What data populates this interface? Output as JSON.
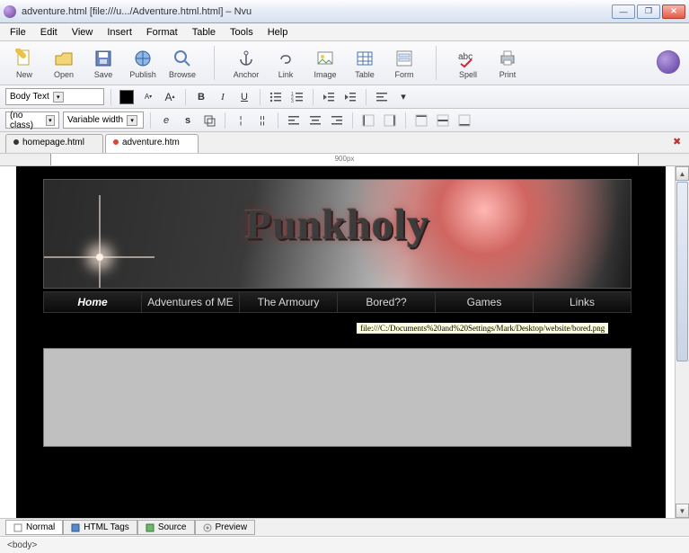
{
  "window": {
    "title": "adventure.html [file:///u.../Adventure.html.html] – Nvu"
  },
  "menu": [
    "File",
    "Edit",
    "View",
    "Insert",
    "Format",
    "Table",
    "Tools",
    "Help"
  ],
  "toolbar": {
    "items": [
      {
        "label": "New",
        "icon": "new"
      },
      {
        "label": "Open",
        "icon": "open"
      },
      {
        "label": "Save",
        "icon": "save"
      },
      {
        "label": "Publish",
        "icon": "publish"
      },
      {
        "label": "Browse",
        "icon": "browse"
      },
      {
        "label": "Anchor",
        "icon": "anchor"
      },
      {
        "label": "Link",
        "icon": "link"
      },
      {
        "label": "Image",
        "icon": "image"
      },
      {
        "label": "Table",
        "icon": "table"
      },
      {
        "label": "Form",
        "icon": "form"
      },
      {
        "label": "Spell",
        "icon": "spell"
      },
      {
        "label": "Print",
        "icon": "print"
      }
    ]
  },
  "format": {
    "para_combo": "Body Text",
    "case_combo": "(no class)",
    "width_combo": "Variable width"
  },
  "tabs": [
    {
      "label": "homepage.html",
      "color": "#333",
      "active": false
    },
    {
      "label": "adventure.htm",
      "color": "#d43",
      "active": true
    }
  ],
  "ruler": {
    "center_label": "900px"
  },
  "site": {
    "logo": "Punkholy",
    "nav": [
      "Home",
      "Adventures of ME",
      "The Armoury",
      "Bored??",
      "Games",
      "Links"
    ],
    "nav_active": 0,
    "tooltip": "file:///C:/Documents%20and%20Settings/Mark/Desktop/website/bored.png"
  },
  "viewtabs": [
    {
      "label": "Normal",
      "active": true
    },
    {
      "label": "HTML Tags",
      "active": false
    },
    {
      "label": "Source",
      "active": false
    },
    {
      "label": "Preview",
      "active": false
    }
  ],
  "status": "<body>"
}
